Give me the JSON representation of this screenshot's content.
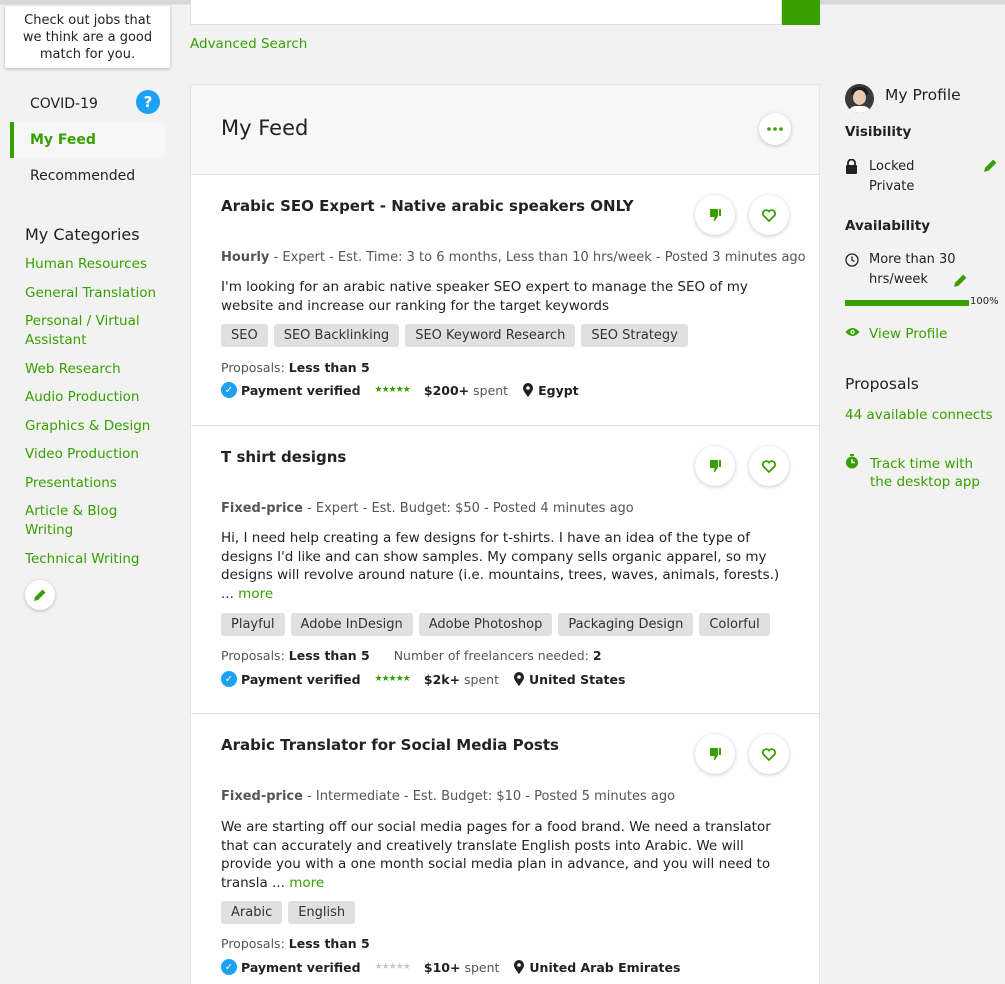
{
  "left": {
    "tooltip": "Check out jobs that we think are a good match for you.",
    "nav": [
      {
        "label": "COVID-19",
        "badge": "?"
      },
      {
        "label": "My Feed",
        "active": true
      },
      {
        "label": "Recommended"
      }
    ],
    "categories_title": "My Categories",
    "categories": [
      "Human Resources",
      "General Translation",
      "Personal / Virtual Assistant",
      "Web Research",
      "Audio Production",
      "Graphics & Design",
      "Video Production",
      "Presentations",
      "Article & Blog Writing",
      "Technical Writing"
    ]
  },
  "search": {
    "advanced_label": "Advanced Search"
  },
  "feed": {
    "title": "My Feed",
    "more_icon": "ellipsis-icon",
    "jobs": [
      {
        "title": "Arabic SEO Expert - Native arabic speakers ONLY",
        "type": "Hourly",
        "meta": " - Expert - Est. Time: 3 to 6 months, Less than 10 hrs/week - Posted 3 minutes ago",
        "description": "I'm looking for an arabic native speaker SEO expert to manage the SEO of my website and increase our ranking for the target keywords",
        "more": "",
        "tags": [
          "SEO",
          "SEO Backlinking",
          "SEO Keyword Research",
          "SEO Strategy"
        ],
        "proposals_label": "Proposals: ",
        "proposals_value": "Less than 5",
        "freelancers_label": "",
        "freelancers_value": "",
        "payment": "Payment verified",
        "spent_amount": "$200+",
        "spent_label": "spent",
        "country": "Egypt",
        "rating": 5
      },
      {
        "title": "T shirt designs",
        "type": "Fixed-price",
        "meta": " - Expert - Est. Budget: $50 - Posted 4 minutes ago",
        "description": "Hi, I need help creating a few designs for t-shirts. I have an idea of the type of designs I'd like and can show samples. My company sells organic apparel, so my designs will revolve around nature (i.e. mountains, trees, waves, animals, forests.) ...",
        "more": "more",
        "tags": [
          "Playful",
          "Adobe InDesign",
          "Adobe Photoshop",
          "Packaging Design",
          "Colorful"
        ],
        "proposals_label": "Proposals: ",
        "proposals_value": "Less than 5",
        "freelancers_label": "Number of freelancers needed: ",
        "freelancers_value": "2",
        "payment": "Payment verified",
        "spent_amount": "$2k+",
        "spent_label": "spent",
        "country": "United States",
        "rating": 5
      },
      {
        "title": "Arabic Translator for Social Media Posts",
        "type": "Fixed-price",
        "meta": " - Intermediate - Est. Budget: $10 - Posted 5 minutes ago",
        "description": "We are starting off our social media pages for a food brand. We need a translator that can accurately and creatively translate English posts into Arabic. We will provide you with a one month social media plan in advance, and you will need to transla ...",
        "more": "more",
        "tags": [
          "Arabic",
          "English"
        ],
        "proposals_label": "Proposals: ",
        "proposals_value": "Less than 5",
        "freelancers_label": "",
        "freelancers_value": "",
        "payment": "Payment verified",
        "spent_amount": "$10+",
        "spent_label": "spent",
        "country": "United Arab Emirates",
        "rating": 0
      }
    ]
  },
  "profile": {
    "title": "My Profile",
    "visibility_label": "Visibility",
    "visibility_value_1": "Locked",
    "visibility_value_2": "Private",
    "availability_label": "Availability",
    "availability_value_1": "More than 30",
    "availability_value_2": "hrs/week",
    "completeness": 1.0,
    "completeness_label": "100%",
    "view_profile": "View Profile",
    "proposals_label": "Proposals",
    "connects": "44 available connects",
    "track_time_1": "Track time with",
    "track_time_2": "the desktop app"
  },
  "colors": {
    "accent": "#37a000",
    "info": "#1da1f2"
  }
}
